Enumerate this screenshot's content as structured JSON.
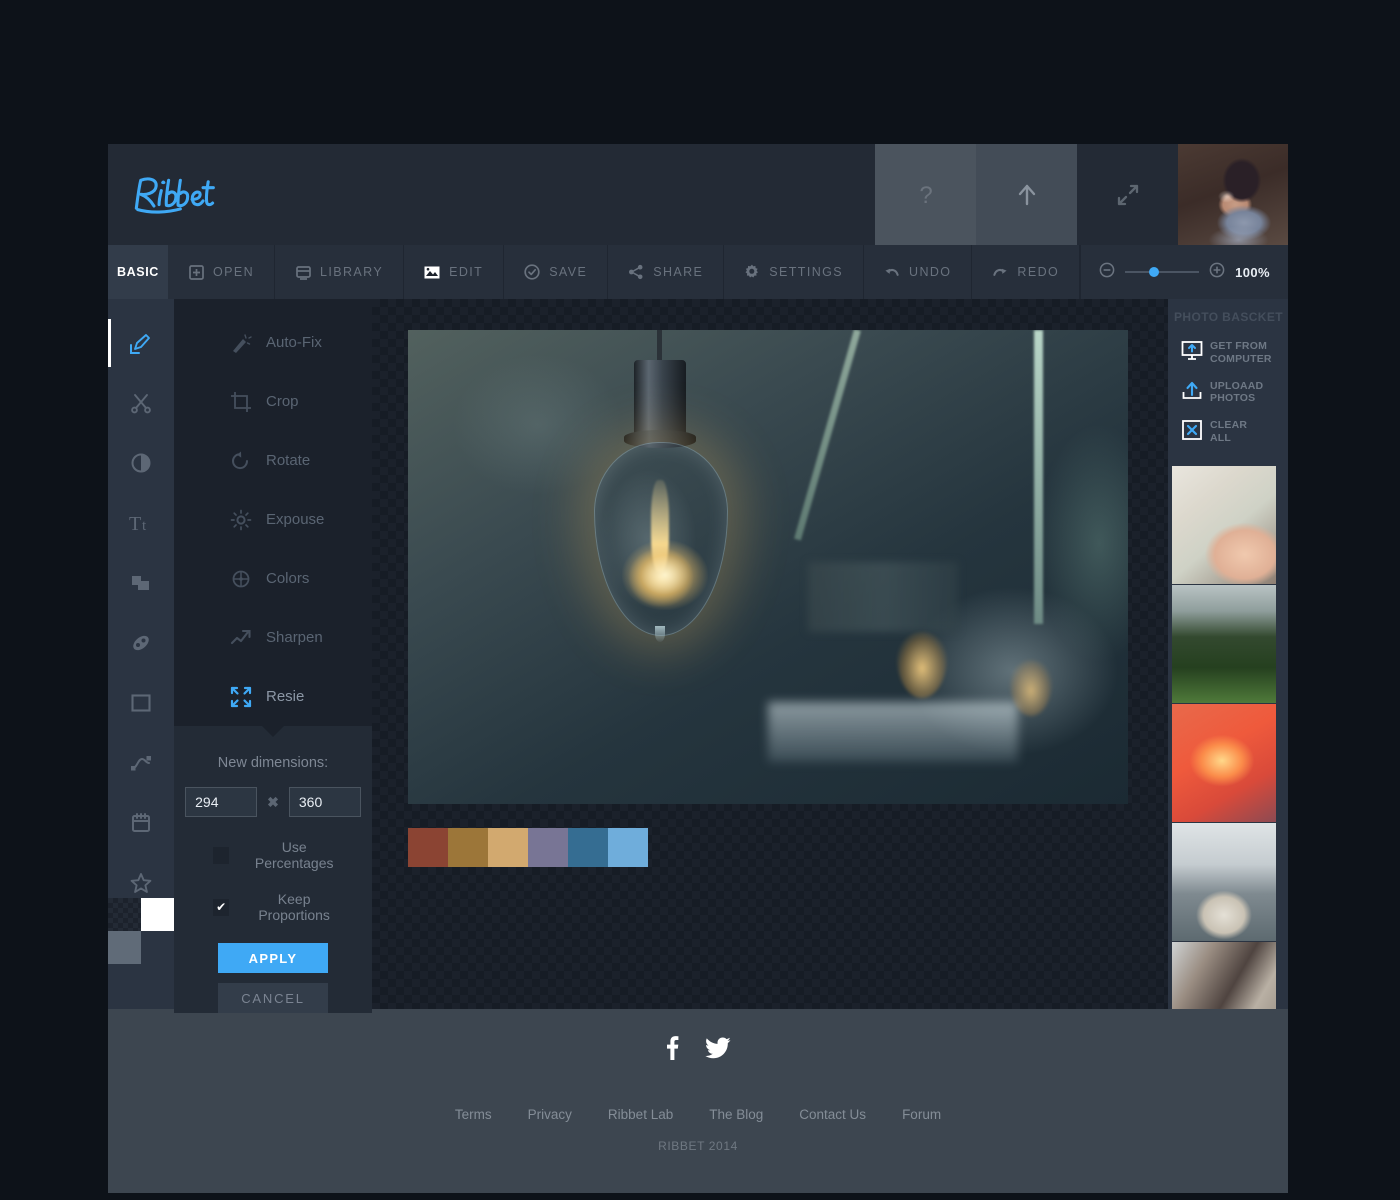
{
  "brand": {
    "name": "Ribbet"
  },
  "header": {
    "buttons": [
      {
        "name": "help-button",
        "icon": "question-mark-icon",
        "label": "?"
      },
      {
        "name": "upload-button",
        "icon": "upload-arrow-icon",
        "label": ""
      },
      {
        "name": "fullscreen-button",
        "icon": "expand-arrows-icon",
        "label": ""
      }
    ],
    "avatar_alt": "user-avatar"
  },
  "toolbar": {
    "active_tab": "BASIC",
    "items": [
      {
        "label": "OPEN",
        "icon": "open-folder-icon"
      },
      {
        "label": "LIBRARY",
        "icon": "library-icon"
      },
      {
        "label": "EDIT",
        "icon": "edit-image-icon",
        "active": true
      },
      {
        "label": "SAVE",
        "icon": "save-check-icon"
      },
      {
        "label": "SHARE",
        "icon": "share-nodes-icon"
      },
      {
        "label": "SETTINGS",
        "icon": "gear-icon"
      },
      {
        "label": "UNDO",
        "icon": "undo-arrow-icon"
      },
      {
        "label": "REDO",
        "icon": "redo-arrow-icon"
      }
    ],
    "zoom": {
      "value": "100%",
      "minus": "-",
      "plus": "+"
    }
  },
  "rail": {
    "items": [
      {
        "name": "basic-edit",
        "icon": "pencil-edit-icon",
        "active": true
      },
      {
        "name": "cut",
        "icon": "scissors-icon"
      },
      {
        "name": "contrast",
        "icon": "contrast-circle-icon"
      },
      {
        "name": "text",
        "icon": "text-tool-icon"
      },
      {
        "name": "layers",
        "icon": "layers-icon"
      },
      {
        "name": "touchup",
        "icon": "touchup-icon"
      },
      {
        "name": "frame",
        "icon": "frame-square-icon"
      },
      {
        "name": "curve",
        "icon": "curve-path-icon"
      },
      {
        "name": "sticker",
        "icon": "sticker-calendar-icon"
      },
      {
        "name": "favorites",
        "icon": "star-icon"
      }
    ],
    "swatches": {
      "transparent": "checker",
      "foreground": "#ffffff",
      "background": "#606b78"
    }
  },
  "flyout": {
    "items": [
      {
        "label": "Auto-Fix",
        "icon": "magic-wand-icon",
        "active": false
      },
      {
        "label": "Crop",
        "icon": "crop-icon",
        "active": false
      },
      {
        "label": "Rotate",
        "icon": "rotate-icon",
        "active": false
      },
      {
        "label": "Expouse",
        "icon": "sun-exposure-icon",
        "active": false
      },
      {
        "label": "Colors",
        "icon": "color-wheel-icon",
        "active": false
      },
      {
        "label": "Sharpen",
        "icon": "sharpen-arrow-icon",
        "active": false
      },
      {
        "label": "Resie",
        "icon": "resize-arrows-icon",
        "active": true
      }
    ]
  },
  "resize_panel": {
    "title": "New dimensions:",
    "width_value": "294",
    "height_value": "360",
    "separator": "✖",
    "use_percentages": {
      "label": "Use Percentages",
      "checked": false
    },
    "keep_proportions": {
      "label": "Keep Proportions",
      "checked": true,
      "check_glyph": "✔"
    },
    "apply_label": "APPLY",
    "cancel_label": "CANCEL"
  },
  "canvas": {
    "image_alt": "glowing-vintage-light-bulb",
    "palette": [
      "#8b4433",
      "#9c7639",
      "#d2a96f",
      "#787595",
      "#356d92",
      "#6faddb"
    ]
  },
  "basket": {
    "title": "PHOTO BASCKET",
    "actions": [
      {
        "label": "GET FROM\nCOMPUTER",
        "line1": "GET FROM",
        "line2": "COMPUTER",
        "icon": "computer-upload-icon"
      },
      {
        "label": "UPLOAAD\nPHOTOS",
        "line1": "UPLOAAD",
        "line2": "PHOTOS",
        "icon": "upload-tray-icon"
      },
      {
        "label": "CLEAR\nALL",
        "line1": "CLEAR",
        "line2": "ALL",
        "icon": "clear-x-icon"
      }
    ],
    "thumbnails": [
      {
        "alt": "hands-holding-paper-map"
      },
      {
        "alt": "foggy-forest-hillside"
      },
      {
        "alt": "orange-lily-flowers"
      },
      {
        "alt": "street-scene-with-backpacker"
      },
      {
        "alt": "hanging-bags-and-straps"
      }
    ]
  },
  "footer": {
    "social": [
      {
        "name": "facebook-icon",
        "glyph": "f"
      },
      {
        "name": "twitter-icon",
        "glyph": "t"
      }
    ],
    "links": [
      "Terms",
      "Privacy",
      "Ribbet Lab",
      "The Blog",
      "Contact Us",
      "Forum"
    ],
    "copyright": "RIBBET 2014"
  }
}
